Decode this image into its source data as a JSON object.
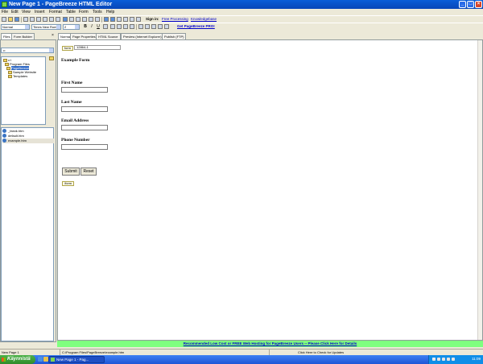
{
  "window": {
    "title": "New Page 1 - PageBreeze HTML Editor",
    "min_label": "_",
    "max_label": "□",
    "close_label": "×"
  },
  "menu": [
    "File",
    "Edit",
    "View",
    "Insert",
    "Format",
    "Table",
    "Form",
    "Tools",
    "Help"
  ],
  "toolbar1": {
    "sign_in_label": "Sign in:",
    "link1": "Free Processing",
    "link2": "Knowledgebase"
  },
  "toolbar2": {
    "style_select": "Normal",
    "font_select": "Times New Roma",
    "size_select": "2",
    "bold": "B",
    "italic": "I",
    "underline": "U",
    "pro_link": "Get PageBreeze PRO!"
  },
  "left_panel": {
    "tabs": [
      "Files",
      "Form Builder"
    ],
    "close_label": "×",
    "drive": "c:",
    "folders": [
      {
        "label": "c:\\"
      },
      {
        "label": "Program Files"
      },
      {
        "label": "PageBreeze",
        "selected": true
      },
      {
        "label": "Sample Website"
      },
      {
        "label": "Templates"
      }
    ],
    "files": [
      {
        "label": "_blank.htm",
        "selected": false
      },
      {
        "label": "default.htm",
        "selected": false
      },
      {
        "label": "example.htm",
        "selected": true
      }
    ]
  },
  "editor": {
    "tabs": [
      "Normal",
      "Page Properties",
      "HTML Source",
      "Preview (Internet Explorer)",
      "Publish (FTP)"
    ],
    "form_tag_label": "form",
    "hidden_field_value": "12864-1",
    "form_end_label": "/form",
    "heading": "Example Form",
    "fields": [
      {
        "label": "First Name"
      },
      {
        "label": "Last Name"
      },
      {
        "label": "Email Address"
      },
      {
        "label": "Phone Number"
      }
    ],
    "submit_label": "Submit",
    "reset_label": "Reset"
  },
  "ad_bar": {
    "text": "Recommended Low Cost or FREE Web Hosting for PageBreeze Users -- Please Click Here for Details"
  },
  "statusbar": {
    "page": "New Page 1",
    "path": "C:\\Program Files\\PageBreeze\\example.htm",
    "updates": "Click Here to Check for Updates"
  },
  "taskbar": {
    "start_label": "Käynnistä",
    "task_label": "New Page 1 - Pag...",
    "lang": "FI",
    "clock": "11:09"
  },
  "colors": {
    "titlebar": "#0a5ed8",
    "ad_bar": "#7fff7f",
    "link": "#0000cc",
    "selection": "#316ac5"
  }
}
